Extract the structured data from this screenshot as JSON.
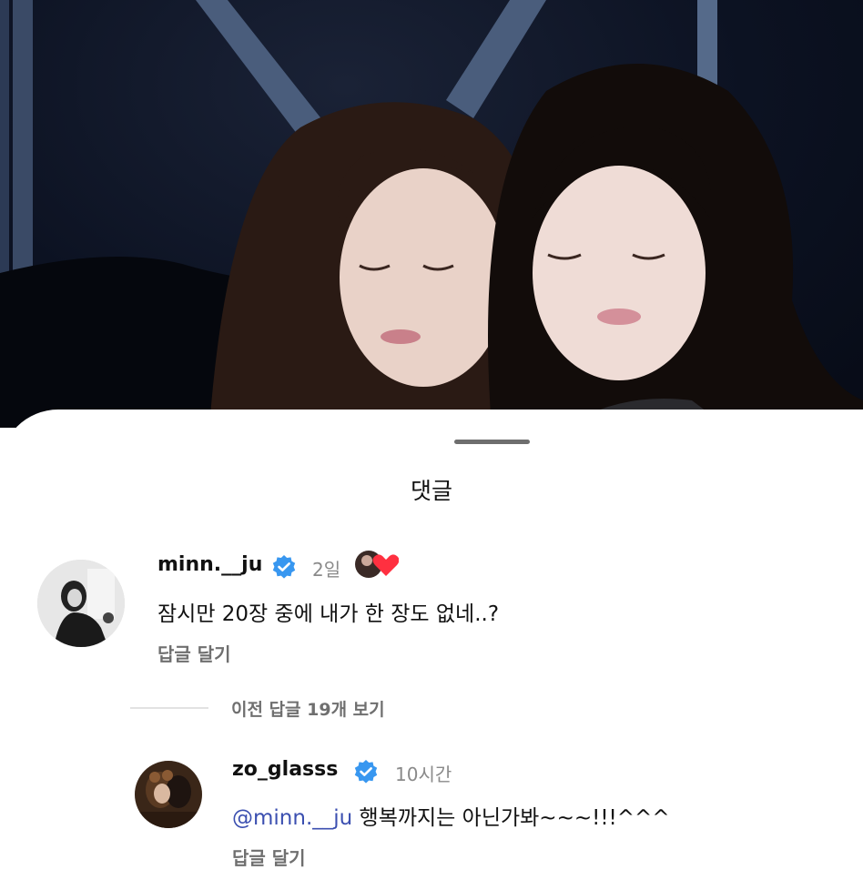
{
  "sheet": {
    "title": "댓글"
  },
  "comments": [
    {
      "username": "minn.__ju",
      "time": "2일",
      "text": "잠시만 20장 중에 내가 한 장도 없네..?",
      "reply_label": "답글 달기"
    }
  ],
  "view_previous_replies": "이전 답글 19개 보기",
  "replies": [
    {
      "username": "zo_glasss",
      "time": "10시간",
      "mention": "@minn.__ju",
      "text": " 행복까지는 아닌가봐~~~!!!^^^",
      "reply_label": "답글 달기"
    }
  ],
  "colors": {
    "verified": "#3897f0",
    "heart": "#ff3040",
    "mention": "#3b4fb0"
  }
}
